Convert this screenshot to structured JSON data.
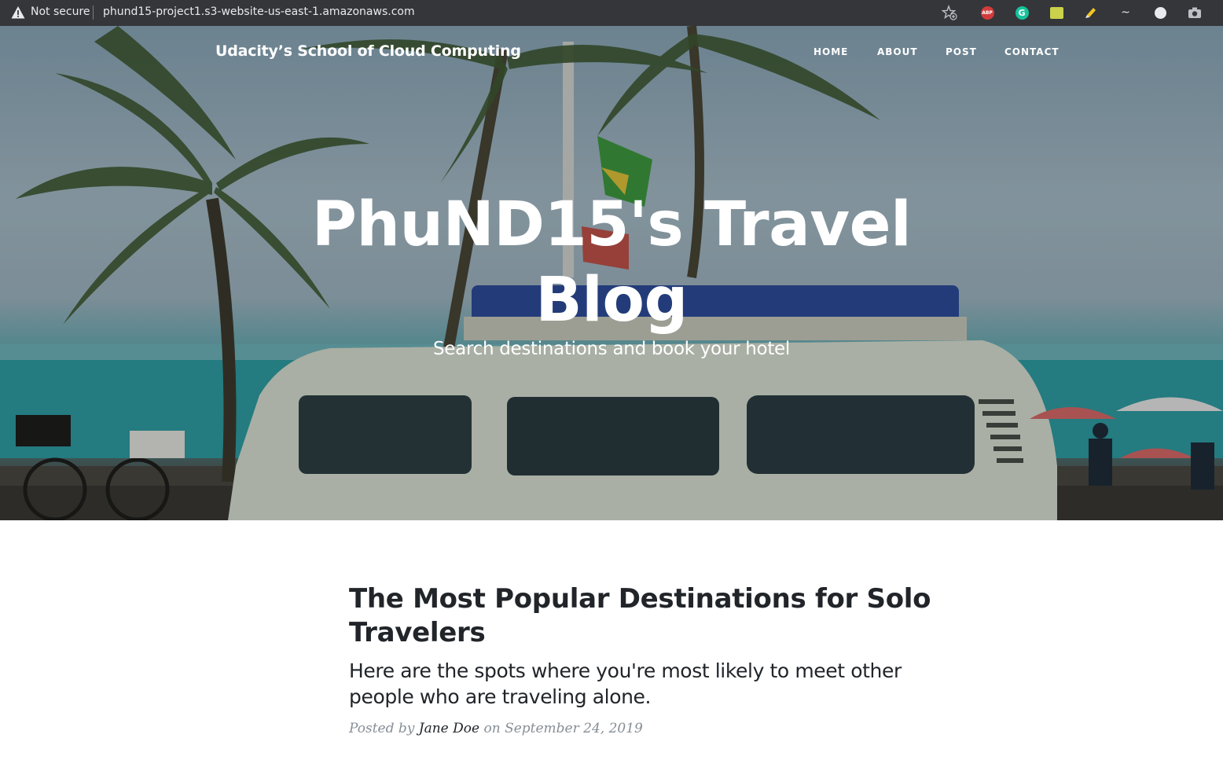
{
  "browser": {
    "security_label": "Not secure",
    "url": "phund15-project1.s3-website-us-east-1.amazonaws.com",
    "extensions": [
      "bookmark-star-icon",
      "adblock-plus-icon",
      "grammarly-icon",
      "sticky-note-icon",
      "highlighter-icon",
      "tilde-icon",
      "globe-icon",
      "camera-icon"
    ],
    "abp_text": "ABP",
    "grammarly_text": "G",
    "tilde_text": "~"
  },
  "navbar": {
    "brand": "Udacity’s School of Cloud Computing",
    "links": [
      "HOME",
      "ABOUT",
      "POST",
      "CONTACT"
    ]
  },
  "hero": {
    "title_line1": "PhuND15's Travel",
    "title_line2": "Blog",
    "subtitle": "Search destinations and book your hotel"
  },
  "post": {
    "title": "The Most Popular Destinations for Solo Travelers",
    "subtitle": "Here are the spots where you're most likely to meet other people who are traveling alone.",
    "meta_posted_by": "Posted by",
    "author": "Jane Doe",
    "meta_on": "on",
    "date": "September 24, 2019"
  },
  "colors": {
    "browser_bar": "#35363a",
    "text_dark": "#212529",
    "meta_gray": "#868e96"
  }
}
